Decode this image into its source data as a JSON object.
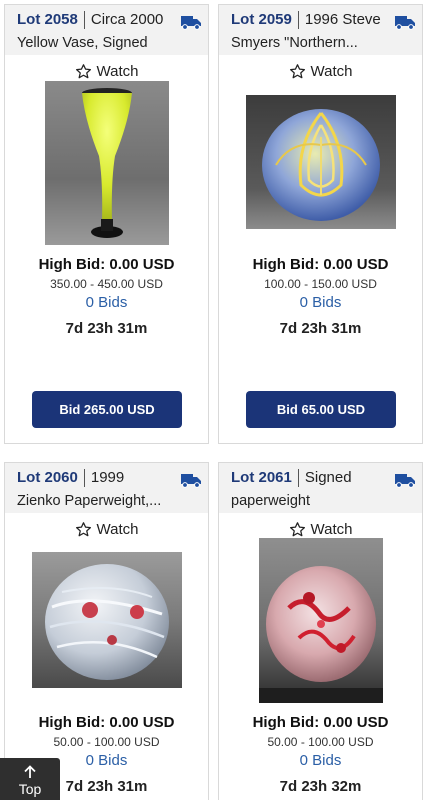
{
  "lots": [
    {
      "lot_label": "Lot 2058",
      "title_line1": "Circa 2000",
      "title_line2": "Yellow Vase, Signed",
      "watch_label": "Watch",
      "high_bid": "High Bid: 0.00 USD",
      "estimate": "350.00 - 450.00 USD",
      "bids": "0 Bids",
      "time_left": "7d 23h 31m",
      "bid_button": "Bid 265.00 USD"
    },
    {
      "lot_label": "Lot 2059",
      "title_line1": "1996 Steve",
      "title_line2": "Smyers \"Northern...",
      "watch_label": "Watch",
      "high_bid": "High Bid: 0.00 USD",
      "estimate": "100.00 - 150.00 USD",
      "bids": "0 Bids",
      "time_left": "7d 23h 31m",
      "bid_button": "Bid 65.00 USD"
    },
    {
      "lot_label": "Lot 2060",
      "title_line1": "1999",
      "title_line2": "Zienko Paperweight,...",
      "watch_label": "Watch",
      "high_bid": "High Bid: 0.00 USD",
      "estimate": "50.00 - 100.00 USD",
      "bids": "0 Bids",
      "time_left": "7d 23h 31m"
    },
    {
      "lot_label": "Lot 2061",
      "title_line1": "Signed",
      "title_line2": "paperweight",
      "watch_label": "Watch",
      "high_bid": "High Bid: 0.00 USD",
      "estimate": "50.00 - 100.00 USD",
      "bids": "0 Bids",
      "time_left": "7d 23h 32m"
    }
  ],
  "top_button": {
    "label": "Top",
    "icon": "arrow-up-icon"
  },
  "icons": {
    "shipping": "truck-icon",
    "watch": "star-outline-icon"
  },
  "colors": {
    "lot_number": "#1f3a78",
    "bid_button": "#1b3478",
    "bids_link": "#2b5fa6"
  }
}
